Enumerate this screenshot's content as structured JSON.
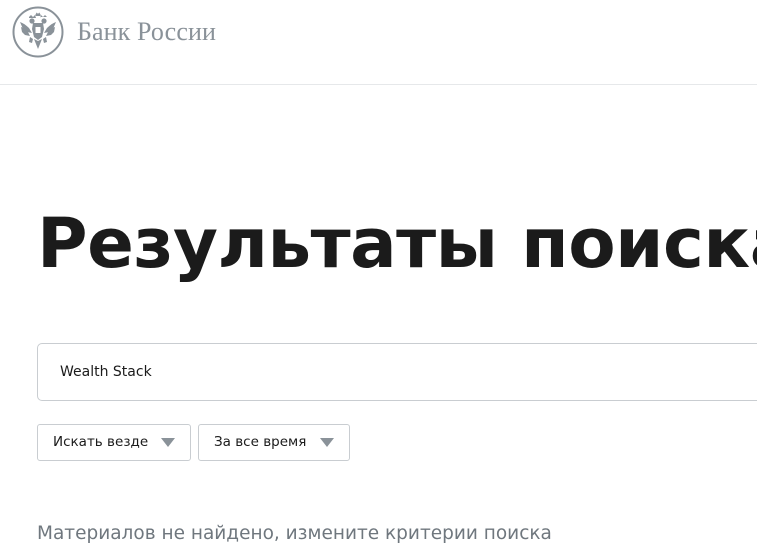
{
  "header": {
    "logo_icon": "double-headed-eagle-icon",
    "logo_text": "Банк России",
    "border_color": "#e6e8ea"
  },
  "main": {
    "title": "Результаты поиска",
    "search": {
      "value": "Wealth Stack",
      "placeholder": ""
    },
    "filters": [
      {
        "label": "Искать везде",
        "icon": "chevron-down-icon"
      },
      {
        "label": "За все время",
        "icon": "chevron-down-icon"
      }
    ],
    "empty_message": "Материалов не найдено, измените критерии поиска"
  },
  "colors": {
    "text": "#1b1b1b",
    "muted": "#6f777e",
    "logo": "#8a9299",
    "border": "#c9cdd1"
  }
}
